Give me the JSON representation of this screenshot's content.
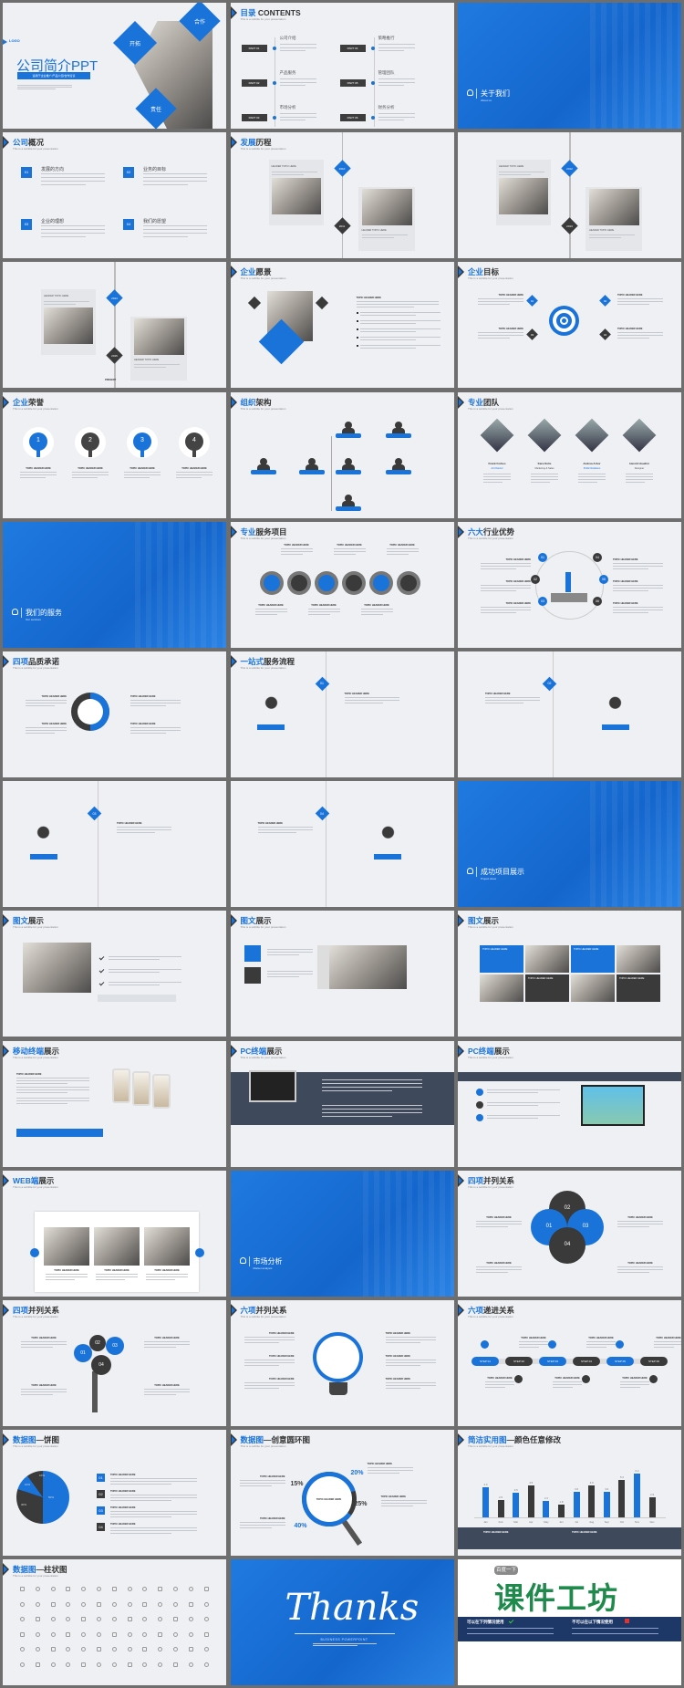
{
  "colors": {
    "accent": "#1a73d9",
    "dark": "#3a3a3a",
    "slide_bg": "#eef0f4",
    "frame": "#6e6e6e"
  },
  "common": {
    "subtitle": "This is a subtitle for your presentation",
    "topic": "TOPIC HEADER HERE",
    "header_topic": "HEADER TOPIC HERE"
  },
  "slides": [
    {
      "kind": "cover",
      "logo": "LOGO",
      "title": "公司简介PPT",
      "tagline": "适用于企业推广/产品介绍/合作洽谈",
      "diamonds": [
        "开拓",
        "合作",
        "责任"
      ]
    },
    {
      "kind": "contents",
      "title_b": "目录",
      "title_d": " CONTENTS",
      "parts": [
        {
          "tag": "PART 01",
          "name": "公司介绍"
        },
        {
          "tag": "PART 02",
          "name": "产品服务"
        },
        {
          "tag": "PART 03",
          "name": "市场分析"
        },
        {
          "tag": "PART 04",
          "name": "策略推行"
        },
        {
          "tag": "PART 05",
          "name": "管理团队"
        },
        {
          "tag": "PART 06",
          "name": "财务分析"
        }
      ]
    },
    {
      "kind": "section",
      "title": "关于我们",
      "sub": "About us",
      "icon": "users-icon"
    },
    {
      "kind": "items4",
      "title_b": "公司",
      "title_d": "概况",
      "items": [
        {
          "num": "01",
          "name": "发展的方向"
        },
        {
          "num": "02",
          "name": "业务的目标"
        },
        {
          "num": "03",
          "name": "企业的理想"
        },
        {
          "num": "04",
          "name": "我们的愿望"
        }
      ]
    },
    {
      "kind": "timeline",
      "title_b": "发展",
      "title_d": "历程",
      "years": [
        "2010",
        "2011"
      ]
    },
    {
      "kind": "timeline",
      "title_b": "",
      "title_d": "",
      "years": [
        "2012",
        "2013"
      ]
    },
    {
      "kind": "timeline",
      "title_b": "",
      "title_d": "",
      "years": [
        "2014",
        "2015"
      ],
      "end": "PRESENT"
    },
    {
      "kind": "vision",
      "title_b": "企业",
      "title_d": "愿景",
      "labels": [
        "TOPIC HEADER HERE"
      ]
    },
    {
      "kind": "goals",
      "title_b": "企业",
      "title_d": "目标",
      "nums": [
        "01",
        "02",
        "03",
        "04"
      ]
    },
    {
      "kind": "trophies",
      "title_b": "企业",
      "title_d": "荣誉",
      "nums": [
        "1",
        "2",
        "3",
        "4"
      ]
    },
    {
      "kind": "org",
      "title_b": "组织",
      "title_d": "架构"
    },
    {
      "kind": "team",
      "title_b": "专业",
      "title_d": "团队",
      "people": [
        {
          "name": "Frank Forbes",
          "role": "Art Director"
        },
        {
          "name": "Kara Kulis",
          "role": "Marketing & Sales"
        },
        {
          "name": "Andrea Arbor",
          "role": "Public Relations"
        },
        {
          "name": "Harold Houdini",
          "role": "Designer"
        }
      ]
    },
    {
      "kind": "section",
      "title": "我们的服务",
      "sub": "Our services",
      "icon": "wrench-icon"
    },
    {
      "kind": "gears",
      "title_b": "专业",
      "title_d": "服务项目"
    },
    {
      "kind": "six",
      "title_b": "六大",
      "title_d": "行业优势",
      "nums": [
        "01",
        "02",
        "03",
        "04",
        "05",
        "06"
      ]
    },
    {
      "kind": "quality",
      "title_b": "四项",
      "title_d": "品质承诺"
    },
    {
      "kind": "process",
      "title_b": "一站式",
      "title_d": "服务流程",
      "num": "01"
    },
    {
      "kind": "process",
      "title_b": "",
      "title_d": "",
      "num": "02"
    },
    {
      "kind": "process",
      "title_b": "",
      "title_d": "",
      "num": "03"
    },
    {
      "kind": "process",
      "title_b": "",
      "title_d": "",
      "num": "04"
    },
    {
      "kind": "section",
      "title": "成功项目展示",
      "sub": "Project show",
      "icon": "monitor-icon"
    },
    {
      "kind": "gallery",
      "title_b": "图文",
      "title_d": "展示"
    },
    {
      "kind": "gallery2",
      "title_b": "图文",
      "title_d": "展示"
    },
    {
      "kind": "gallery3",
      "title_b": "图文",
      "title_d": "展示"
    },
    {
      "kind": "mobile",
      "title_b": "移动终端",
      "title_d": "展示"
    },
    {
      "kind": "pc",
      "title_b": "PC终端",
      "title_d": "展示"
    },
    {
      "kind": "pc2",
      "title_b": "PC终端",
      "title_d": "展示"
    },
    {
      "kind": "web",
      "title_b": "WEB端",
      "title_d": "展示"
    },
    {
      "kind": "section",
      "title": "市场分析",
      "sub": "Market analysis",
      "icon": "chat-icon"
    },
    {
      "kind": "petals",
      "title_b": "四项",
      "title_d": "并列关系",
      "nums": [
        "01",
        "02",
        "03",
        "04"
      ]
    },
    {
      "kind": "tree",
      "title_b": "四项",
      "title_d": "并列关系",
      "nums": [
        "01",
        "02",
        "03",
        "04"
      ]
    },
    {
      "kind": "bulb",
      "title_b": "六项",
      "title_d": "并列关系"
    },
    {
      "kind": "steps",
      "title_b": "六项",
      "title_d": "递进关系",
      "steps": [
        "STEP 01",
        "STEP 02",
        "STEP 03",
        "STEP 04",
        "STEP 05",
        "STEP 06"
      ]
    },
    {
      "kind": "pie",
      "title_b": "数据图",
      "title_d": "—饼图",
      "nums": [
        "01",
        "02",
        "03",
        "04"
      ]
    },
    {
      "kind": "ring",
      "title_b": "数据图",
      "title_d": "—创意圆环图",
      "pcts": [
        "20%",
        "15%",
        "25%",
        "40%"
      ]
    },
    {
      "kind": "bar",
      "title_b": "简洁实用图",
      "title_d": "—颜色任意修改"
    },
    {
      "kind": "icons",
      "title_b": "数据图",
      "title_d": "—柱状图"
    },
    {
      "kind": "thanks",
      "title": "Thanks",
      "sub": "BUSINESS POWERPOINT"
    },
    {
      "kind": "ad",
      "badge": "百度一下",
      "brand": "课件工坊",
      "can": "可以在下列情况使用",
      "cannot": "不可以在以下情况使用"
    }
  ],
  "chart_data": [
    {
      "type": "bar",
      "title": "",
      "categories": [
        "Jan",
        "Feb",
        "Mar",
        "Apr",
        "May",
        "Jun",
        "Jul",
        "Aug",
        "Sep",
        "Oct",
        "Nov",
        "Dec"
      ],
      "values": [
        4.3,
        2.5,
        3.5,
        4.5,
        2.3,
        1.8,
        3.6,
        4.5,
        3.6,
        5.3,
        6.2,
        2.9
      ],
      "colors": [
        "#1a73d9",
        "#3a3a3a"
      ],
      "ylim": [
        0,
        7
      ],
      "grid": false
    },
    {
      "type": "pie",
      "title": "",
      "labels": [
        "50%",
        "30%",
        "10%",
        "10%"
      ],
      "values": [
        50,
        30,
        10,
        10
      ],
      "colors": [
        "#1a73d9",
        "#3a3a3a",
        "#1a73d9",
        "#3a3a3a"
      ]
    }
  ]
}
